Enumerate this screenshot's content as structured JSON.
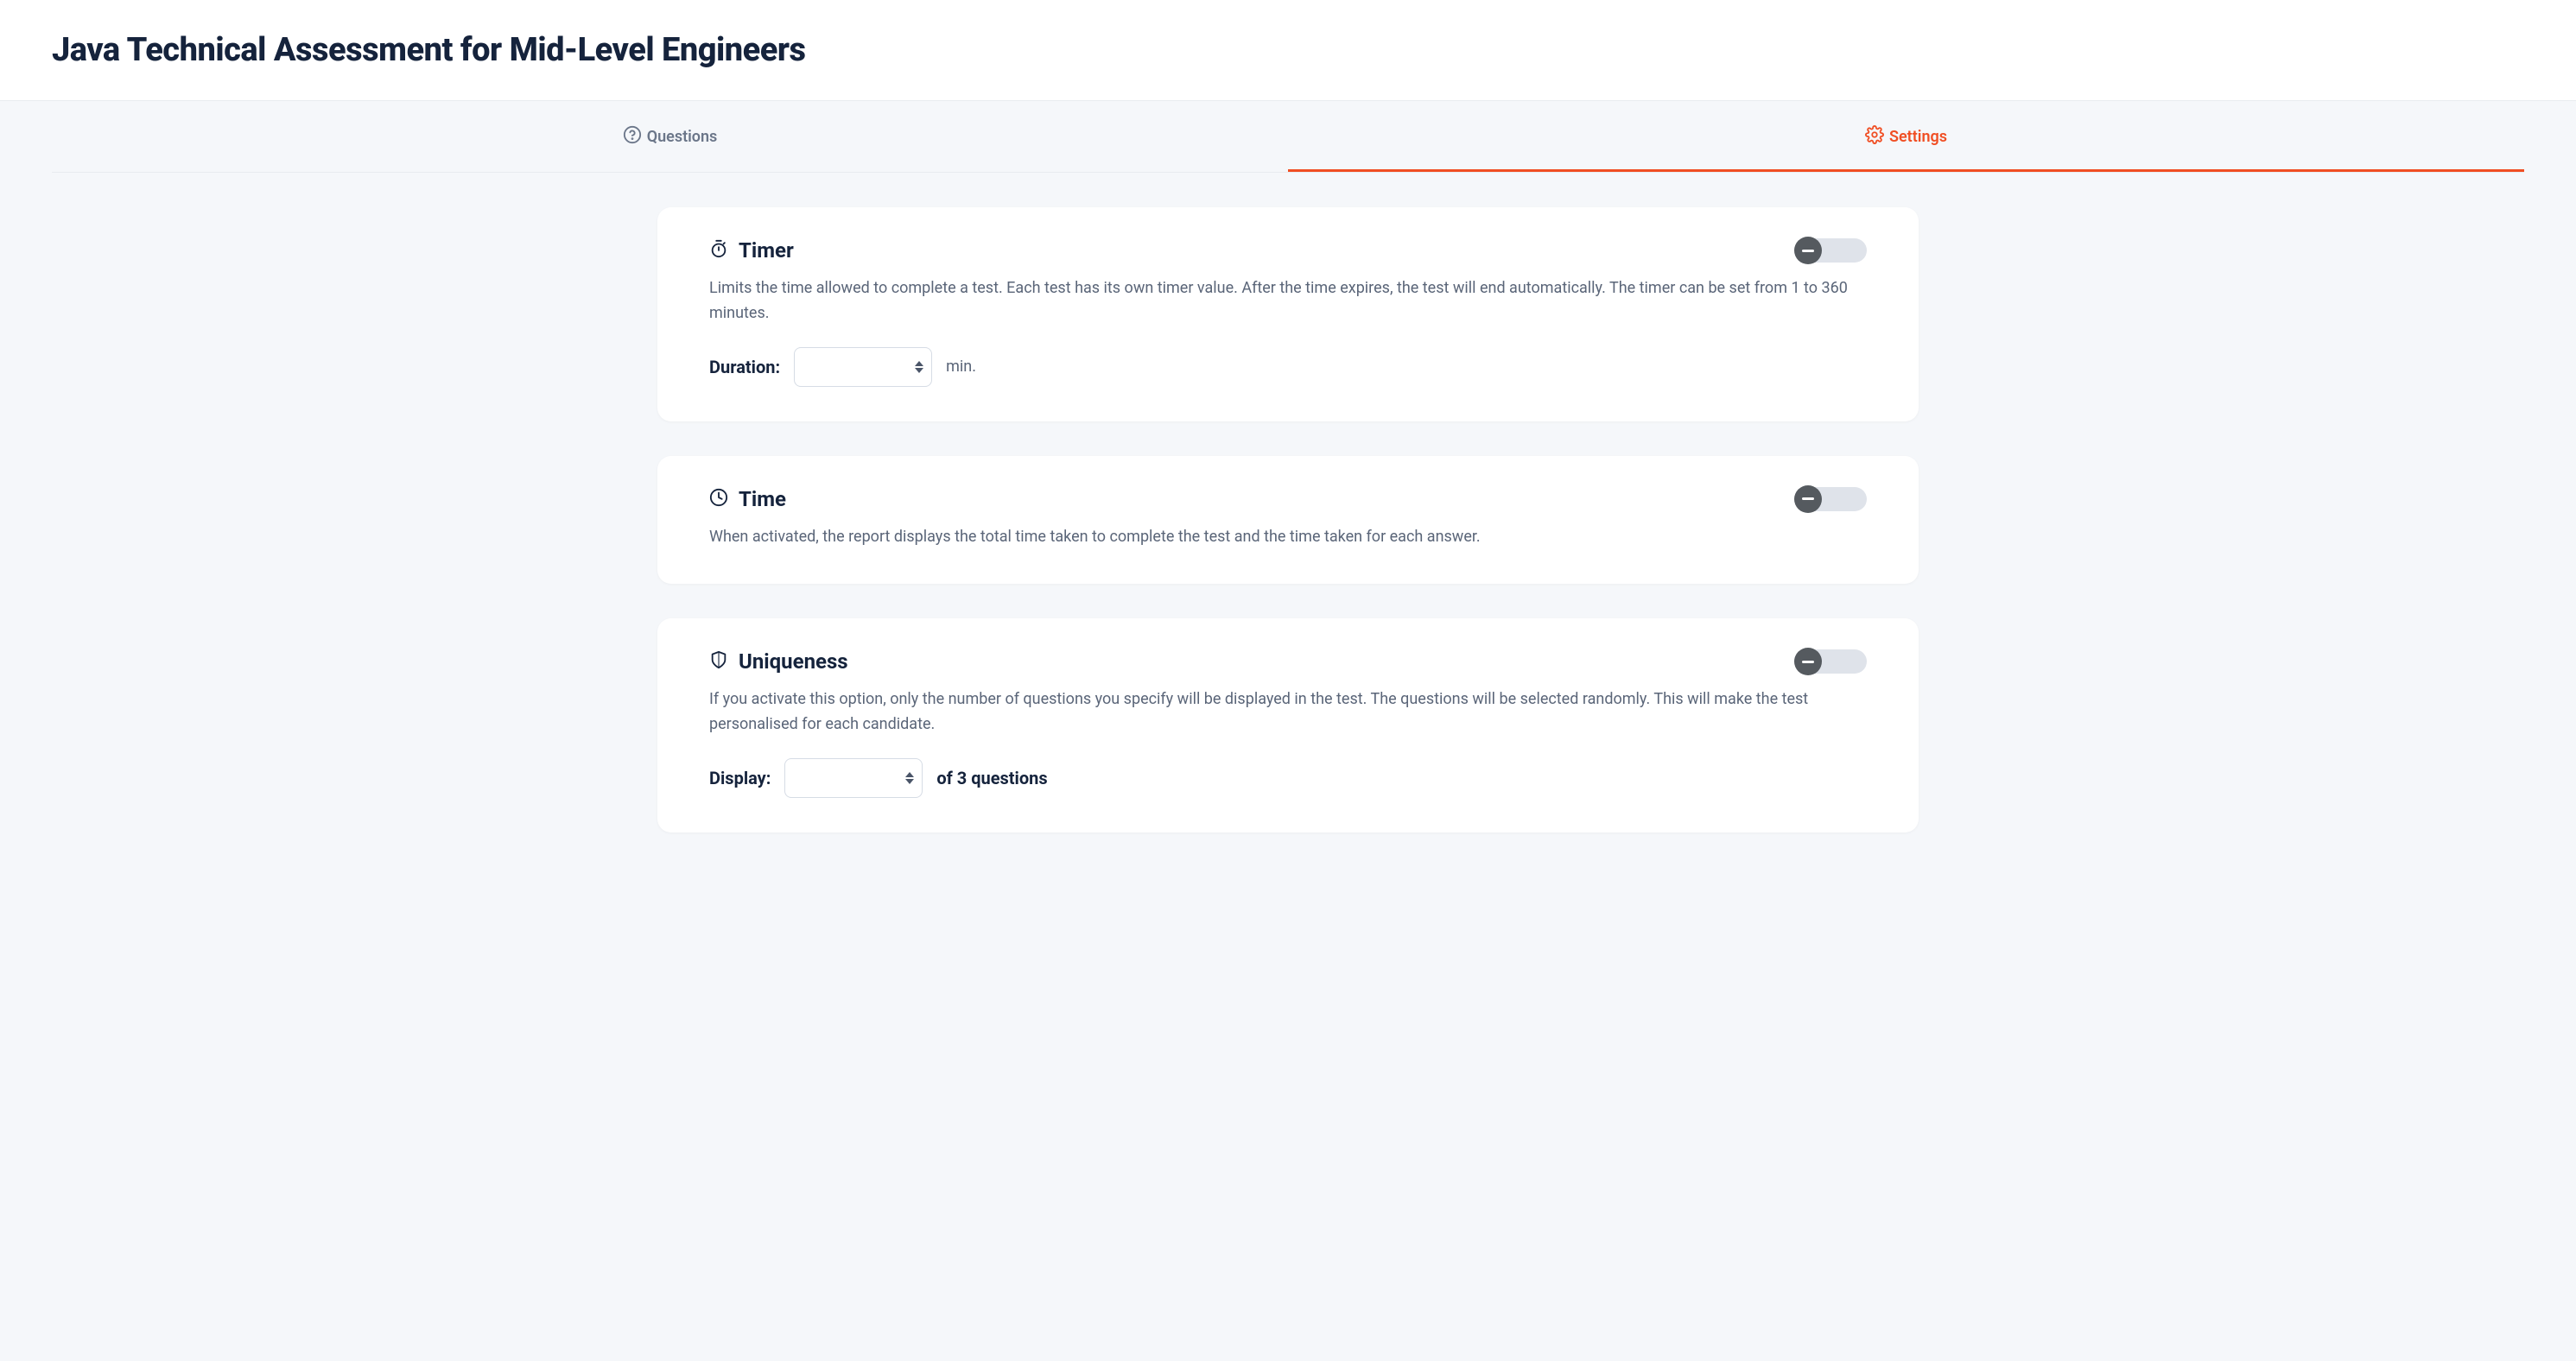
{
  "header": {
    "title": "Java Technical Assessment for Mid-Level Engineers"
  },
  "tabs": {
    "questions": "Questions",
    "settings": "Settings"
  },
  "cards": {
    "timer": {
      "title": "Timer",
      "desc": "Limits the time allowed to complete a test. Each test has its own timer value. After the time expires, the test will end automatically. The timer can be set from 1 to 360 minutes.",
      "duration_label": "Duration:",
      "duration_value": "",
      "unit": "min."
    },
    "time": {
      "title": "Time",
      "desc": "When activated, the report displays the total time taken to complete the test and the time taken for each answer."
    },
    "uniqueness": {
      "title": "Uniqueness",
      "desc": "If you activate this option, only the number of questions you specify will be displayed in the test. The questions will be selected randomly. This will make the test personalised for each candidate.",
      "display_label": "Display:",
      "display_value": "",
      "after_text": "of 3 questions"
    }
  }
}
